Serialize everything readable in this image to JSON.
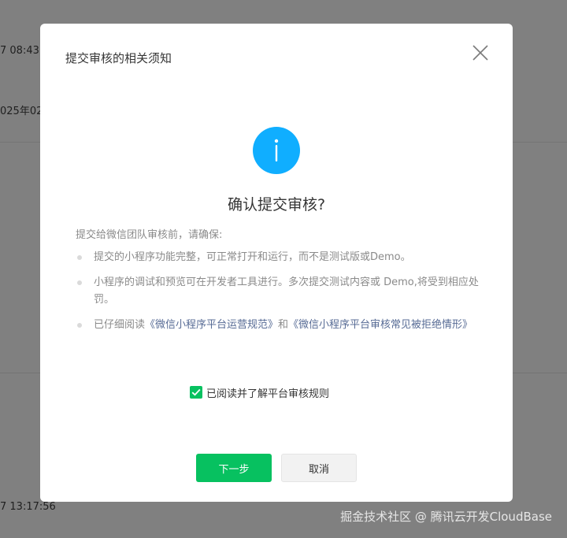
{
  "background": {
    "texts": [
      {
        "text": "7 08:43:"
      },
      {
        "text": "025年02"
      },
      {
        "text": "7 13:17:56"
      }
    ]
  },
  "dialog": {
    "title": "提交审核的相关须知",
    "heading": "确认提交审核?",
    "intro": "提交给微信团队审核前，请确保:",
    "rules": [
      {
        "text": "提交的小程序功能完整，可正常打开和运行，而不是测试版或Demo。"
      },
      {
        "text": "小程序的调试和预览可在开发者工具进行。多次提交测试内容或 Demo,将受到相应处罚。"
      },
      {
        "prefix": "已仔细阅读",
        "link1": "《微信小程序平台运营规范》",
        "middle": "和",
        "link2": "《微信小程序平台审核常见被拒绝情形》"
      }
    ],
    "agree_label": "已阅读并了解平台审核规则",
    "agree_checked": true,
    "next_label": "下一步",
    "cancel_label": "取消"
  },
  "watermark": "掘金技术社区 @ 腾讯云开发CloudBase",
  "colors": {
    "primary": "#07c160",
    "info": "#10aeff",
    "link": "#576b95",
    "overlay": "#808080"
  },
  "icons": {
    "close": "close-icon",
    "info": "info-icon",
    "check": "check-icon"
  }
}
